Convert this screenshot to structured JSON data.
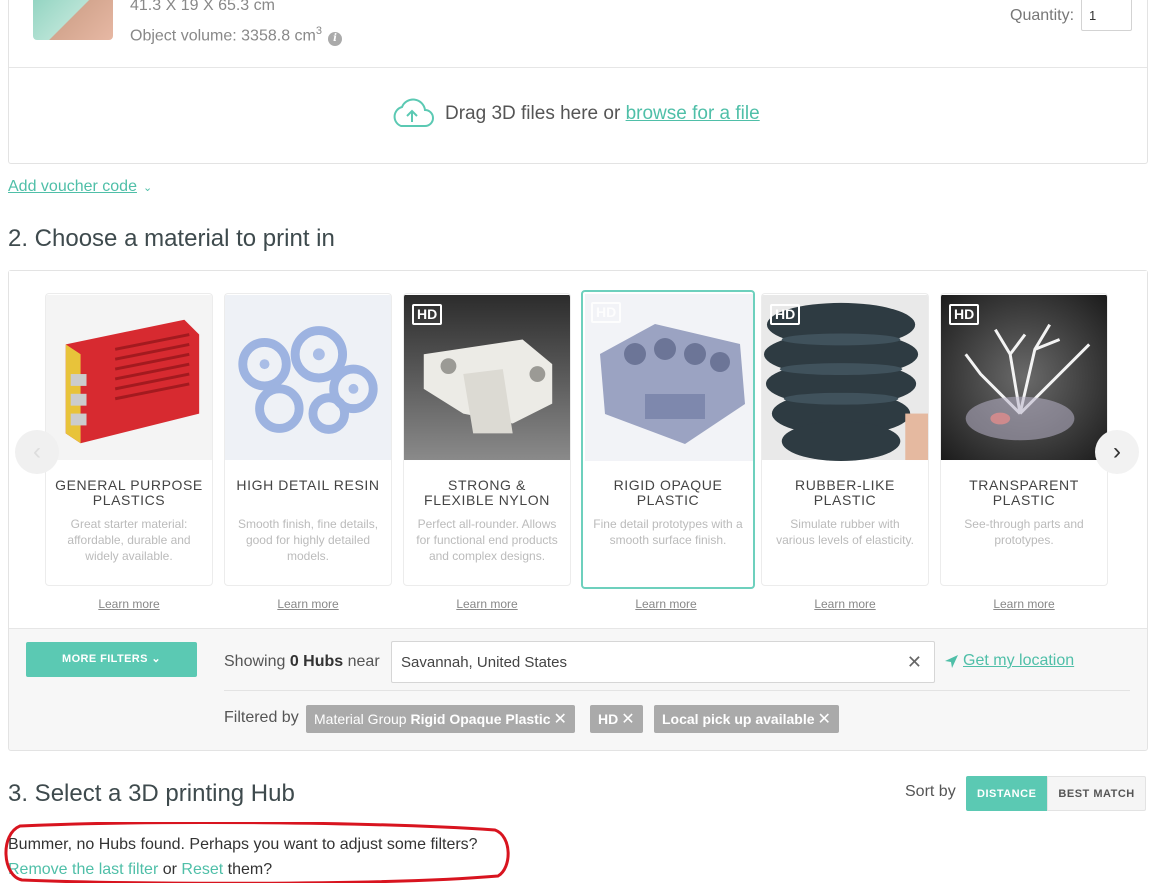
{
  "upload": {
    "dimensions": "41.3 X 19 X 65.3 cm",
    "volume_label": "Object volume: 3358.8 cm",
    "volume_unit_exp": "3",
    "quantity_label": "Quantity:",
    "quantity_value": "1",
    "drag_text": "Drag 3D files here or ",
    "browse_link": "browse for a file"
  },
  "voucher": {
    "label": "Add voucher code",
    "chevron": "⌄"
  },
  "material_section": {
    "heading": "2. Choose a material to print in",
    "prev_arrow": "‹",
    "next_arrow": "›",
    "cards": [
      {
        "title": "GENERAL PURPOSE PLASTICS",
        "desc": "Great starter material: affordable, durable and widely available.",
        "hd": "",
        "learn": "Learn more",
        "selected": false,
        "icon": "red-case-image"
      },
      {
        "title": "HIGH DETAIL RESIN",
        "desc": "Smooth finish, fine details, good for highly detailed models.",
        "hd": "",
        "learn": "Learn more",
        "selected": false,
        "icon": "resin-gears-image"
      },
      {
        "title": "STRONG & FLEXIBLE NYLON",
        "desc": "Perfect all-rounder. Allows for functional end products and complex designs.",
        "hd": "HD",
        "learn": "Learn more",
        "selected": false,
        "icon": "nylon-bracket-image"
      },
      {
        "title": "RIGID OPAQUE PLASTIC",
        "desc": "Fine detail prototypes with a smooth surface finish.",
        "hd": "HD",
        "learn": "Learn more",
        "selected": true,
        "icon": "engine-block-image"
      },
      {
        "title": "RUBBER-LIKE PLASTIC",
        "desc": "Simulate rubber with various levels of elasticity.",
        "hd": "HD",
        "learn": "Learn more",
        "selected": false,
        "icon": "rubber-bellows-image"
      },
      {
        "title": "TRANSPARENT PLASTIC",
        "desc": "See-through parts and prototypes.",
        "hd": "HD",
        "learn": "Learn more",
        "selected": false,
        "icon": "transparent-coral-image"
      }
    ]
  },
  "filters": {
    "more_filters": "MORE FILTERS ⌄",
    "showing_prefix": "Showing ",
    "showing_count": "0 Hubs",
    "showing_suffix": " near",
    "location_value": "Savannah, United States",
    "clear_icon": "✕",
    "get_location": "Get my location",
    "filtered_by": "Filtered by",
    "chips": [
      {
        "prefix": "Material Group ",
        "bold": "Rigid Opaque Plastic"
      },
      {
        "prefix": "",
        "bold": "HD"
      },
      {
        "prefix": "",
        "bold": "Local pick up available"
      }
    ]
  },
  "hub_section": {
    "heading": "3. Select a 3D printing Hub",
    "sort_label": "Sort by",
    "sort_distance": "DISTANCE",
    "sort_best": "BEST MATCH",
    "message": "Bummer, no Hubs found. Perhaps you want to adjust some filters?",
    "remove_link": "Remove the last filter",
    "or_text": " or ",
    "reset_link": "Reset",
    "them_text": " them?"
  },
  "colors": {
    "accent": "#5bc9b3",
    "link": "#4fbfa8",
    "highlight": "#d8141f"
  }
}
